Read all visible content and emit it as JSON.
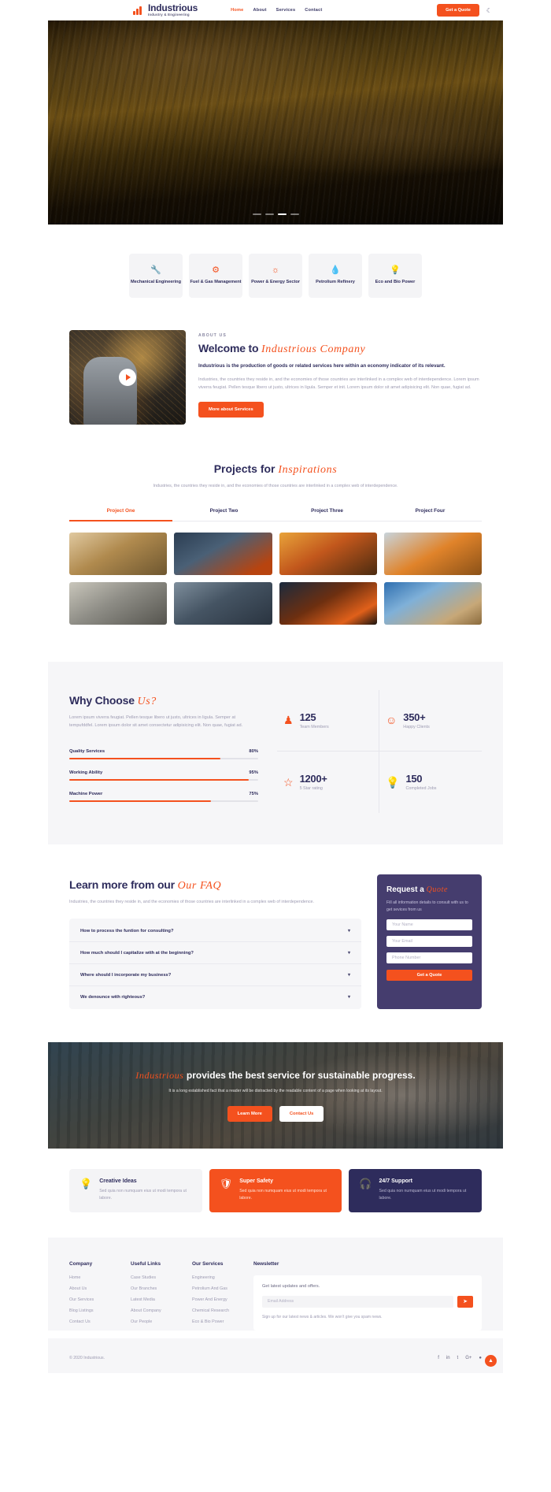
{
  "header": {
    "brand_title": "Industrious",
    "brand_sub": "Industry & Engineering",
    "nav": [
      {
        "label": "Home",
        "active": true
      },
      {
        "label": "About",
        "active": false
      },
      {
        "label": "Services",
        "active": false
      },
      {
        "label": "Contact",
        "active": false
      }
    ],
    "quote_button": "Get a Quote",
    "theme_toggle_icon": "moon-icon"
  },
  "hero": {
    "slides": 4,
    "active_slide": 3
  },
  "services": [
    {
      "icon": "wrench-icon",
      "glyph": "⚒",
      "label": "Mechanical Engineering"
    },
    {
      "icon": "gears-icon",
      "glyph": "⚙",
      "label": "Fuel & Gas Management"
    },
    {
      "icon": "sun-energy-icon",
      "glyph": "☀",
      "label": "Power & Energy Sector"
    },
    {
      "icon": "oil-drop-icon",
      "glyph": "◆",
      "label": "Petrolium Refinery"
    },
    {
      "icon": "bulb-icon",
      "glyph": "☀",
      "label": "Eco and Bio Power"
    }
  ],
  "about": {
    "eyebrow": "ABOUT US",
    "title_plain": "Welcome to ",
    "title_script": "Industrious Company",
    "lead": "Industrious is the production of goods or related services here within an economy indicator of its relevant.",
    "paragraph": "Industries, the countries they reside in, and the economies of those countries are interlinked in a complex web of interdependence. Lorem ipsum viverra feugiat. Pellen tesque libero ut justo, ultrices in ligula. Semper et init. Lorem ipsum dolor sit amet adipisicing elit. Non quae, fugiat ad.",
    "button": "More about Services",
    "play_icon": "play-icon"
  },
  "projects": {
    "title_plain": "Projects for ",
    "title_script": "Inspirations",
    "subtitle": "Industries, the countries they reside in, and the economies of those countries are interlinked in a complex web of interdependence.",
    "tabs": [
      {
        "label": "Project One",
        "active": true
      },
      {
        "label": "Project Two",
        "active": false
      },
      {
        "label": "Project Three",
        "active": false
      },
      {
        "label": "Project Four",
        "active": false
      }
    ]
  },
  "why": {
    "title_plain": "Why Choose ",
    "title_script": "Us?",
    "paragraph": "Lorem ipsum viverra feugiat. Pellen tesque libero ut justo, ultrices in ligula. Semper at tempufddfel. Lorem ipsum dolor sit amet consectetur adipisicing elit. Non quae, fugiat ad.",
    "bars": [
      {
        "label": "Quality Services",
        "value": "80%",
        "pct": 80
      },
      {
        "label": "Working Ability",
        "value": "95%",
        "pct": 95
      },
      {
        "label": "Machine Power",
        "value": "75%",
        "pct": 75
      }
    ],
    "stats": [
      {
        "icon": "user-icon",
        "glyph": "○",
        "number": "125",
        "label": "Team Members"
      },
      {
        "icon": "smile-icon",
        "glyph": "☺",
        "number": "350+",
        "label": "Happy Clients"
      },
      {
        "icon": "star-icon",
        "glyph": "☆",
        "number": "1200+",
        "label": "5 Star rating"
      },
      {
        "icon": "bulb-icon",
        "glyph": "●",
        "number": "150",
        "label": "Completed Jobs"
      }
    ]
  },
  "faq": {
    "title_plain": "Learn more from our ",
    "title_script": "Our FAQ",
    "subtitle": "Industries, the countries they reside in, and the economies of those countries are interlinked in a complex web of interdependence.",
    "items": [
      "How to process the funtion for consulting?",
      "How much should I capitalize with at the beginning?",
      "Where should I incorporate my business?",
      "We denounce with righteous?"
    ],
    "chevron_icon": "chevron-down-icon"
  },
  "quote_form": {
    "title_plain": "Request a ",
    "title_script": "Quote",
    "subtitle": "Fill all information details to consult with us to get sevices from us",
    "name_placeholder": "Your Name",
    "email_placeholder": "Your Email",
    "phone_placeholder": "Phone Number",
    "submit": "Get a Quote"
  },
  "cta": {
    "title_script": "Industrious",
    "title_plain": " provides the best service for sustainable progress.",
    "paragraph": "It is a long established fact that a reader will be distracted by the readable content of a page when looking at its layout.",
    "primary": "Learn More",
    "secondary": "Contact Us"
  },
  "features": [
    {
      "icon": "bulb-icon",
      "glyph": "●",
      "title": "Creative Ideas",
      "desc": "Sed quia non numquam eius ut modi tempora ut labore.",
      "style": "light"
    },
    {
      "icon": "shield-icon",
      "glyph": "◆",
      "title": "Super Safety",
      "desc": "Sed quia non numquam eius ut modi tempora ut labore.",
      "style": "orange"
    },
    {
      "icon": "headset-icon",
      "glyph": "●",
      "title": "24/7 Support",
      "desc": "Sed quia non numquam eius ut modi tempora ut labore.",
      "style": "dark"
    }
  ],
  "footer": {
    "columns": [
      {
        "title": "Company",
        "links": [
          "Home",
          "About Us",
          "Our Services",
          "Blog Listings",
          "Contact Us"
        ]
      },
      {
        "title": "Useful Links",
        "links": [
          "Case Studies",
          "Our Branches",
          "Latest Media",
          "About Company",
          "Our People"
        ]
      },
      {
        "title": "Our Services",
        "links": [
          "Engineering",
          "Petrolium And Gas",
          "Power And Energy",
          "Chemical Research",
          "Eco & Bio Power"
        ]
      }
    ],
    "newsletter": {
      "title": "Newsletter",
      "text": "Get latest updates and offers.",
      "placeholder": "Email Address",
      "button_icon": "send-icon",
      "note": "Sign up for our latest news & articles. We won’t give you spam news."
    },
    "copyright": "© 2020 Industrious.",
    "socials": [
      "facebook-icon",
      "linkedin-icon",
      "twitter-icon",
      "google-plus-icon",
      "dribbble-icon"
    ],
    "social_glyphs": [
      "f",
      "in",
      "t",
      "G+",
      "●"
    ],
    "back_to_top_icon": "arrow-up-icon"
  },
  "colors": {
    "accent": "#f4511e",
    "navy": "#2e2c5c",
    "purple": "#453d6e",
    "muted": "#9d9bb2"
  }
}
